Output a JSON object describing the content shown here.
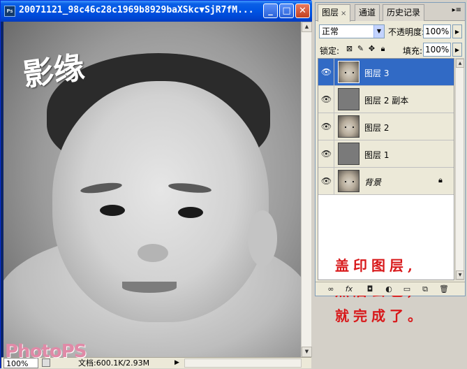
{
  "document": {
    "title": "20071121_98c46c28c1969b8929baXSkc▼SjR7fM...",
    "window_buttons": [
      "minimize",
      "maximize",
      "close"
    ],
    "status": {
      "zoom": "100%",
      "doc_info": "文档:600.1K/2.93M"
    },
    "logo_text": "影缘",
    "watermark": "PhotoPS"
  },
  "panel": {
    "tabs": [
      {
        "label": "图层",
        "active": true
      },
      {
        "label": "通道",
        "active": false
      },
      {
        "label": "历史记录",
        "active": false
      }
    ],
    "blend_mode": "正常",
    "opacity_label": "不透明度:",
    "opacity_value": "100%",
    "lock_label": "锁定:",
    "fill_label": "填充:",
    "fill_value": "100%",
    "layers": [
      {
        "name": "图层 3",
        "visible": true,
        "selected": true,
        "thumb": "face"
      },
      {
        "name": "图层 2 副本",
        "visible": true,
        "selected": false,
        "thumb": "gray"
      },
      {
        "name": "图层 2",
        "visible": true,
        "selected": false,
        "thumb": "face"
      },
      {
        "name": "图层 1",
        "visible": true,
        "selected": false,
        "thumb": "gray"
      },
      {
        "name": "背景",
        "visible": true,
        "selected": false,
        "thumb": "face",
        "locked": true
      }
    ],
    "note_lines": [
      "盖印图层,",
      "然后去色,",
      "就完成了。"
    ],
    "note_color": "#d8181a",
    "selection_color": "#316ac5"
  }
}
